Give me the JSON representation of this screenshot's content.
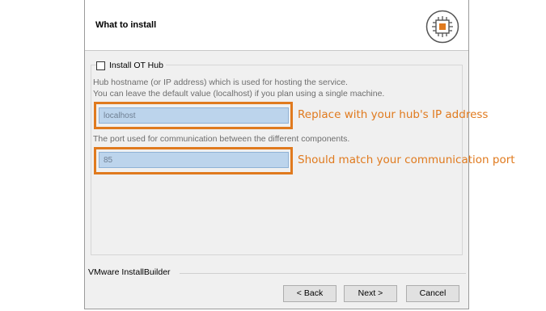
{
  "header": {
    "title": "What to install",
    "logo_icon": "chip-icon"
  },
  "install_checkbox": {
    "label": "Install OT Hub",
    "checked": false
  },
  "hostname": {
    "description_line1": "Hub hostname (or IP address) which is used for hosting the service.",
    "description_line2": "You can leave the default value (localhost) if you plan using a single machine.",
    "value": "localhost"
  },
  "port": {
    "description": "The port used for communication between the different components.",
    "value": "85"
  },
  "annotations": {
    "hostname_note": "Replace with your hub's IP address",
    "port_note": "Should match your communication port",
    "color": "#e07a1e"
  },
  "footer": {
    "brand": "VMware InstallBuilder",
    "back_label": "< Back",
    "next_label": "Next >",
    "cancel_label": "Cancel"
  }
}
